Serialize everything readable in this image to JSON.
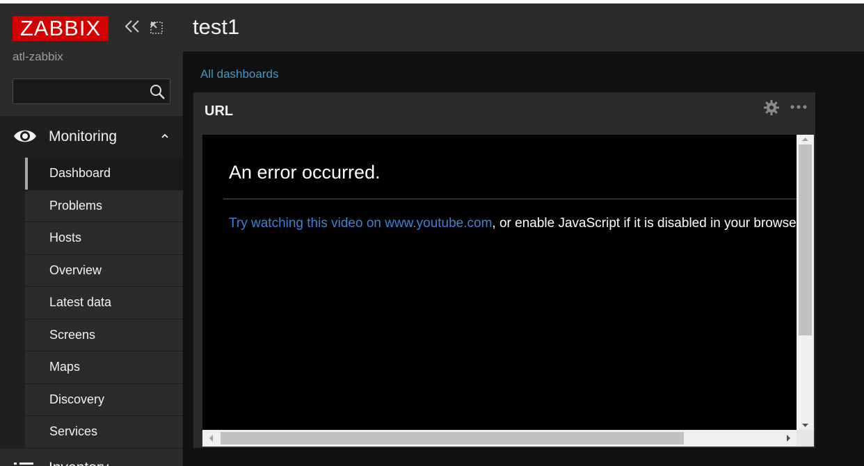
{
  "brand": {
    "logo_text": "ZABBIX",
    "server_name": "atl-zabbix"
  },
  "search": {
    "value": "",
    "placeholder": ""
  },
  "menu": {
    "monitoring_label": "Monitoring",
    "items": [
      {
        "label": "Dashboard",
        "active": true
      },
      {
        "label": "Problems"
      },
      {
        "label": "Hosts"
      },
      {
        "label": "Overview"
      },
      {
        "label": "Latest data"
      },
      {
        "label": "Screens"
      },
      {
        "label": "Maps"
      },
      {
        "label": "Discovery"
      },
      {
        "label": "Services"
      }
    ],
    "inventory_label": "Inventory"
  },
  "header": {
    "title": "test1"
  },
  "breadcrumb": {
    "all_dashboards": "All dashboards"
  },
  "widget": {
    "title": "URL",
    "error_title": "An error occurred.",
    "error_link": "Try watching this video on www.youtube.com",
    "error_rest": ", or enable JavaScript if it is disabled in your browser."
  },
  "colors": {
    "brand_red": "#d40000",
    "link_blue": "#4796c4",
    "video_link_blue": "#3f7fd8"
  },
  "icons": [
    "collapse-icon",
    "kiosk-mode-icon",
    "search-icon",
    "eye-icon",
    "chevron-up-icon",
    "gear-icon",
    "more-icon",
    "list-icon"
  ]
}
